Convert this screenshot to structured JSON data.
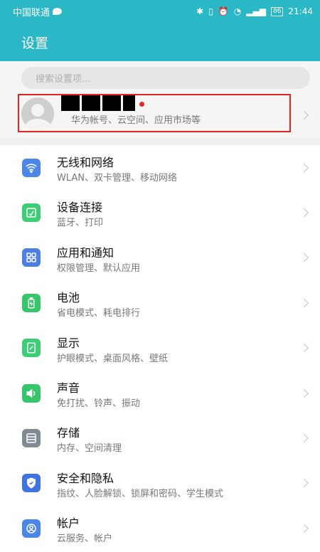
{
  "status_bar": {
    "carrier": "中国联通",
    "battery": "86",
    "time": "21:44"
  },
  "app_bar": {
    "title": "设置"
  },
  "search": {
    "placeholder": "搜索设置项..."
  },
  "account": {
    "name": "■■■■",
    "subtitle": "华为帐号、云空间、应用市场等"
  },
  "items": [
    {
      "title": "无线和网络",
      "subtitle": "WLAN、双卡管理、移动网络",
      "icon": "wifi-icon",
      "color": "#4c86e9"
    },
    {
      "title": "设备连接",
      "subtitle": "蓝牙、打印",
      "icon": "device-connection-icon",
      "color": "#3ccd76"
    },
    {
      "title": "应用和通知",
      "subtitle": "权限管理、默认应用",
      "icon": "apps-icon",
      "color": "#4c7ee8"
    },
    {
      "title": "电池",
      "subtitle": "省电模式、耗电排行",
      "icon": "battery-icon",
      "color": "#38c66b"
    },
    {
      "title": "显示",
      "subtitle": "护眼模式、桌面风格、壁纸",
      "icon": "display-icon",
      "color": "#3ccd76"
    },
    {
      "title": "声音",
      "subtitle": "免打扰、铃声、振动",
      "icon": "sound-icon",
      "color": "#36c56a"
    },
    {
      "title": "存储",
      "subtitle": "内存、空间清理",
      "icon": "storage-icon",
      "color": "#7f8a92"
    },
    {
      "title": "安全和隐私",
      "subtitle": "指纹、人脸解锁、锁屏和密码、学生模式",
      "icon": "shield-icon",
      "color": "#3f73e0"
    },
    {
      "title": "帐户",
      "subtitle": "云服务、帐户",
      "icon": "account-icon",
      "color": "#4c86e9"
    }
  ]
}
